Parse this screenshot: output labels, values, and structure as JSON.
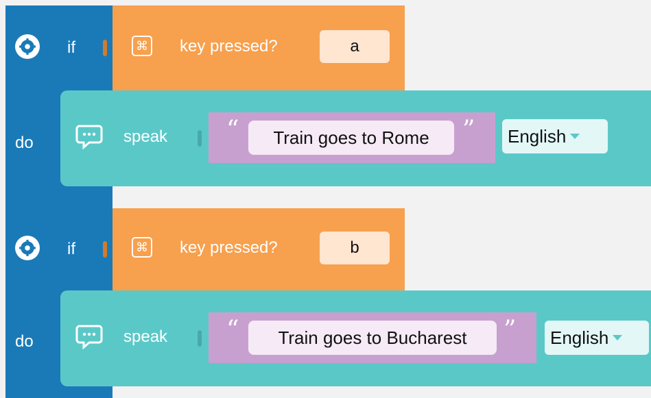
{
  "blocks": [
    {
      "if_label": "if",
      "do_label": "do",
      "condition": {
        "label": "key pressed?",
        "key": "a"
      },
      "action": {
        "label": "speak",
        "text": "Train goes to Rome",
        "language": "English"
      }
    },
    {
      "if_label": "if",
      "do_label": "do",
      "condition": {
        "label": "key pressed?",
        "key": "b"
      },
      "action": {
        "label": "speak",
        "text": "Train goes to Bucharest",
        "language": "English"
      }
    }
  ],
  "icons": {
    "gear": "gear-icon",
    "key": "command-key-icon",
    "speak": "speech-bubble-icon"
  },
  "colors": {
    "control": "#1a7ab8",
    "sensing": "#f7a04d",
    "speech": "#5bc8c8",
    "text": "#c8a0cf"
  }
}
